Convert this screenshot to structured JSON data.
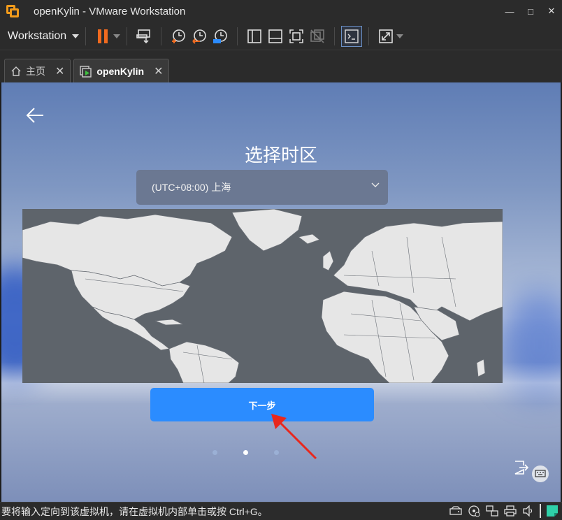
{
  "window": {
    "title": "openKylin - VMware Workstation",
    "controls": {
      "minimize": "—",
      "maximize": "□",
      "close": "✕"
    }
  },
  "toolbar": {
    "menu_label": "Workstation",
    "icons": [
      "pause-icon",
      "send-ctrl-alt-del-icon",
      "snapshot-take-icon",
      "snapshot-revert-icon",
      "snapshot-manager-icon",
      "sidebar-view-icon",
      "console-view-icon",
      "fullscreen-icon",
      "unity-icon",
      "terminal-icon",
      "stretch-icon"
    ]
  },
  "tabs": [
    {
      "label": "主页",
      "icon": "home-icon",
      "active": false
    },
    {
      "label": "openKylin",
      "icon": "vm-running-icon",
      "active": true
    }
  ],
  "vm": {
    "title": "选择时区",
    "timezone": "(UTC+08:00) 上海",
    "next_label": "下一步",
    "page_dots": 3,
    "active_dot": 2
  },
  "statusbar": {
    "text": "要将输入定向到该虚拟机，请在虚拟机内部单击或按 Ctrl+G。",
    "icons": [
      "hdd-icon",
      "cdrom-icon",
      "network-icon",
      "printer-icon",
      "sound-icon",
      "notes-icon"
    ]
  },
  "colors": {
    "accent_orange": "#f06a1f",
    "button_blue": "#2b8cff",
    "map_ocean": "#5e646b",
    "map_land": "#e6e6e6"
  }
}
